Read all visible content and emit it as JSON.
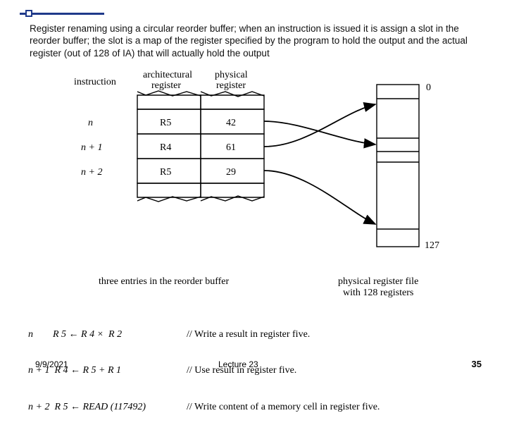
{
  "description": "Register renaming using a circular reorder buffer; when an instruction is issued it is assign a slot in the reorder buffer; the slot is a map of the register  specified by the program to hold the output and the actual register (out of 128 of IA) that will actually hold the output",
  "diagram": {
    "headers": {
      "instruction": "instruction",
      "arch": "architectural\nregister",
      "phys": "physical\nregister"
    },
    "rows": [
      {
        "instr": "n",
        "arch": "R5",
        "phys": "42"
      },
      {
        "instr": "n + 1",
        "arch": "R4",
        "phys": "61"
      },
      {
        "instr": "n + 2",
        "arch": "R5",
        "phys": "29"
      }
    ],
    "prf_top": "0",
    "prf_bottom": "127",
    "caption_left": "three entries in the reorder buffer",
    "caption_right": "physical register file\nwith 128 registers"
  },
  "code": [
    {
      "lhs": "n        R 5 ← R 4 ×  R 2",
      "rhs": "// Write a result in register five."
    },
    {
      "lhs": "n + 1  R 4 ← R 5 + R 1",
      "rhs": "// Use result in register five."
    },
    {
      "lhs": "n + 2  R 5 ← READ (117492)",
      "rhs": "// Write content of a memory cell in register five."
    }
  ],
  "footer": {
    "date": "9/9/2021",
    "lecture": "Lecture 23",
    "page": "35"
  }
}
